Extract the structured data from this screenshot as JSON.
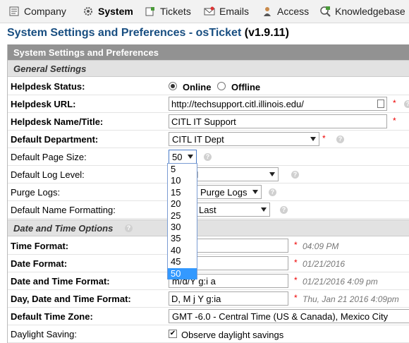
{
  "nav": {
    "items": [
      {
        "label": "Company",
        "icon": "company-icon"
      },
      {
        "label": "System",
        "icon": "gear-icon"
      },
      {
        "label": "Tickets",
        "icon": "tickets-icon"
      },
      {
        "label": "Emails",
        "icon": "email-icon"
      },
      {
        "label": "Access",
        "icon": "access-icon"
      },
      {
        "label": "Knowledgebase",
        "icon": "knowledgebase-icon"
      }
    ],
    "active": "System"
  },
  "page_title": "System Settings and Preferences - osTicket",
  "version": "(v1.9.11)",
  "panel_header": "System Settings and Preferences",
  "sections": {
    "general": "General Settings",
    "datetime": "Date and Time Options"
  },
  "fields": {
    "helpdesk_status": {
      "label": "Helpdesk Status:",
      "online": "Online",
      "offline": "Offline",
      "value": "Online"
    },
    "helpdesk_url": {
      "label": "Helpdesk URL:",
      "value": "http://techsupport.citl.illinois.edu/"
    },
    "helpdesk_name": {
      "label": "Helpdesk Name/Title:",
      "value": "CITL IT Support"
    },
    "default_department": {
      "label": "Default Department:",
      "value": "CITL IT Dept"
    },
    "default_page_size": {
      "label": "Default Page Size:",
      "value": "50"
    },
    "default_log_level": {
      "label": "Default Log Level:",
      "value_tail": "N"
    },
    "purge_logs": {
      "label": "Purge Logs:",
      "value_tail": "Purge Logs"
    },
    "default_name_formatting": {
      "label": "Default Name Formatting:",
      "value_tail": "Last"
    },
    "time_format": {
      "label": "Time Format:",
      "example": "04:09 PM"
    },
    "date_format": {
      "label": "Date Format:",
      "example": "01/21/2016"
    },
    "date_time_format": {
      "label": "Date and Time Format:",
      "value_tail": "m/d/Y g:i a",
      "example": "01/21/2016 4:09 pm"
    },
    "day_date_time_format": {
      "label": "Day, Date and Time Format:",
      "value": "D, M j Y g:ia",
      "example": "Thu, Jan 21 2016 4:09pm"
    },
    "default_time_zone": {
      "label": "Default Time Zone:",
      "value": "GMT -6.0 - Central Time (US & Canada), Mexico City"
    },
    "daylight_saving": {
      "label": "Daylight Saving:",
      "checkbox_label": "Observe daylight savings",
      "checked": true
    }
  },
  "page_size_options": [
    "5",
    "10",
    "15",
    "20",
    "25",
    "30",
    "35",
    "40",
    "45",
    "50"
  ],
  "page_size_selected": "50",
  "required_mark": "*",
  "colors": {
    "title": "#184e81",
    "header": "#929292",
    "section": "#e2e2e2",
    "selection": "#3399ff",
    "required": "#e00000"
  }
}
